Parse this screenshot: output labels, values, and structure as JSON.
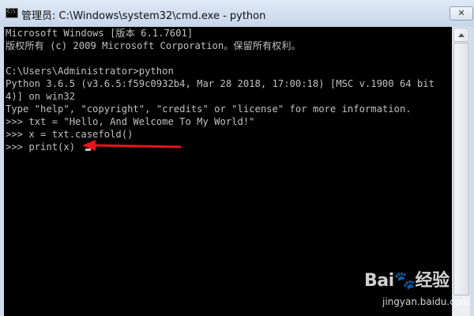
{
  "window": {
    "title": "管理员: C:\\Windows\\system32\\cmd.exe - python",
    "icon": "cmd-icon",
    "icon_text": "C:\\",
    "close_label": "✕"
  },
  "console": {
    "lines": [
      "Microsoft Windows [版本 6.1.7601]",
      "版权所有 (c) 2009 Microsoft Corporation。保留所有权利。",
      "",
      "C:\\Users\\Administrator>python",
      "Python 3.6.5 (v3.6.5:f59c0932b4, Mar 28 2018, 17:00:18) [MSC v.1900 64 bit",
      "4)] on win32",
      "Type \"help\", \"copyright\", \"credits\" or \"license\" for more information.",
      ">>> txt = \"Hello, And Welcome To My World!\"",
      ">>> x = txt.casefold()",
      ">>> print(x)"
    ],
    "text_color": "#c0c0c0",
    "background": "#000000"
  },
  "annotation": {
    "arrow_color": "#e8141c"
  },
  "watermark": {
    "logo": "Bai🐾经验",
    "site": "jingyan.baidu.com"
  }
}
